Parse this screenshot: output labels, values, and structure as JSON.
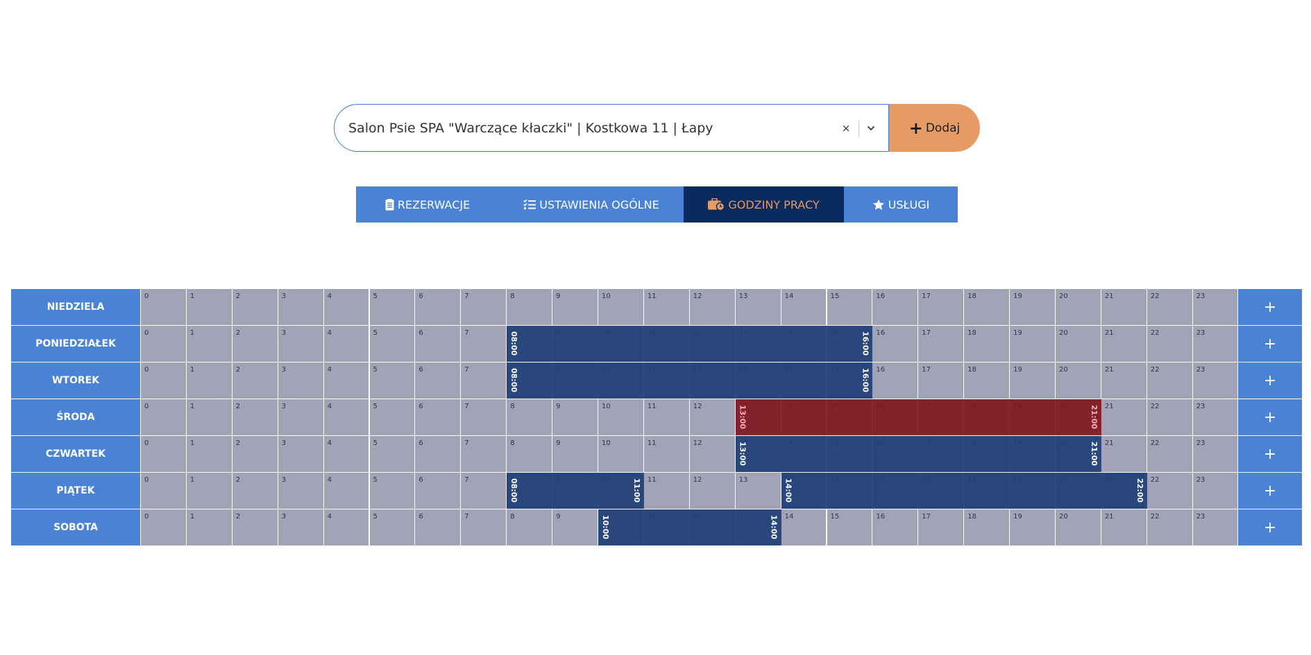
{
  "salon_select": {
    "value": "Salon Psie SPA \"Warczące kłaczki\" | Kostkowa 11 | Łapy",
    "clear_glyph": "×",
    "dropdown_icon": "chevron-down-icon"
  },
  "add_button": {
    "icon": "plus-icon",
    "glyph": "+",
    "label": "Dodaj"
  },
  "tabs": [
    {
      "id": "reservations",
      "label": "REZERWACJE",
      "icon": "clipboard-icon",
      "active": false
    },
    {
      "id": "general-settings",
      "label": "USTAWIENIA OGÓLNE",
      "icon": "list-check-icon",
      "active": false
    },
    {
      "id": "working-hours",
      "label": "GODZINY PRACY",
      "icon": "briefcase-clock-icon",
      "active": true
    },
    {
      "id": "services",
      "label": "USŁUGI",
      "icon": "star-icon",
      "active": false
    }
  ],
  "schedule": {
    "hours": [
      "0",
      "1",
      "2",
      "3",
      "4",
      "5",
      "6",
      "7",
      "8",
      "9",
      "10",
      "11",
      "12",
      "13",
      "14",
      "15",
      "16",
      "17",
      "18",
      "19",
      "20",
      "21",
      "22",
      "23"
    ],
    "add_glyph": "+",
    "colors": {
      "open": "#1e3f76",
      "conflict": "#80141c",
      "empty": "#a3a3b8",
      "day": "#4a82d6"
    },
    "days": [
      {
        "name": "NIEDZIELA",
        "ranges": []
      },
      {
        "name": "PONIEDZIAŁEK",
        "ranges": [
          {
            "start": "08:00",
            "end": "16:00",
            "from": 8,
            "to": 16,
            "state": "open"
          }
        ]
      },
      {
        "name": "WTOREK",
        "ranges": [
          {
            "start": "08:00",
            "end": "16:00",
            "from": 8,
            "to": 16,
            "state": "open"
          }
        ]
      },
      {
        "name": "ŚRODA",
        "ranges": [
          {
            "start": "13:00",
            "end": "21:00",
            "from": 13,
            "to": 21,
            "state": "conflict"
          }
        ]
      },
      {
        "name": "CZWARTEK",
        "ranges": [
          {
            "start": "13:00",
            "end": "21:00",
            "from": 13,
            "to": 21,
            "state": "open"
          }
        ]
      },
      {
        "name": "PIĄTEK",
        "ranges": [
          {
            "start": "08:00",
            "end": "11:00",
            "from": 8,
            "to": 11,
            "state": "open"
          },
          {
            "start": "14:00",
            "end": "22:00",
            "from": 14,
            "to": 22,
            "state": "open"
          }
        ]
      },
      {
        "name": "SOBOTA",
        "ranges": [
          {
            "start": "10:00",
            "end": "14:00",
            "from": 10,
            "to": 14,
            "state": "open"
          }
        ]
      }
    ]
  }
}
